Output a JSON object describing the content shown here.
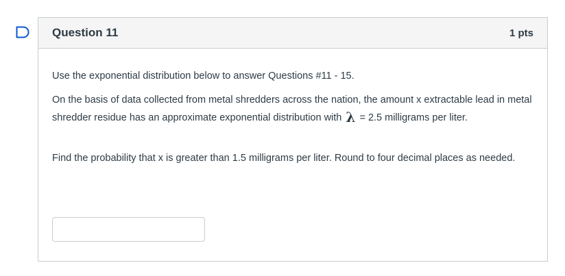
{
  "question": {
    "title": "Question 11",
    "points": "1 pts",
    "intro": "Use the exponential distribution below to answer Questions #11 - 15.",
    "body_before_lambda": "On the basis of data collected from metal shredders across the nation, the amount x extractable lead in metal shredder residue has an approximate exponential distribution with ",
    "lambda_symbol": "λ",
    "body_after_lambda": " = 2.5 milligrams per liter.",
    "prompt": "Find the probability that x is greater than 1.5 milligrams per liter. Round to four decimal places as needed.",
    "answer_value": "",
    "flag_icon": "flag-icon"
  },
  "colors": {
    "header_bg": "#f5f5f5",
    "border": "#c7cdd1",
    "text": "#2d3b45",
    "flag": "#0b57d0"
  }
}
